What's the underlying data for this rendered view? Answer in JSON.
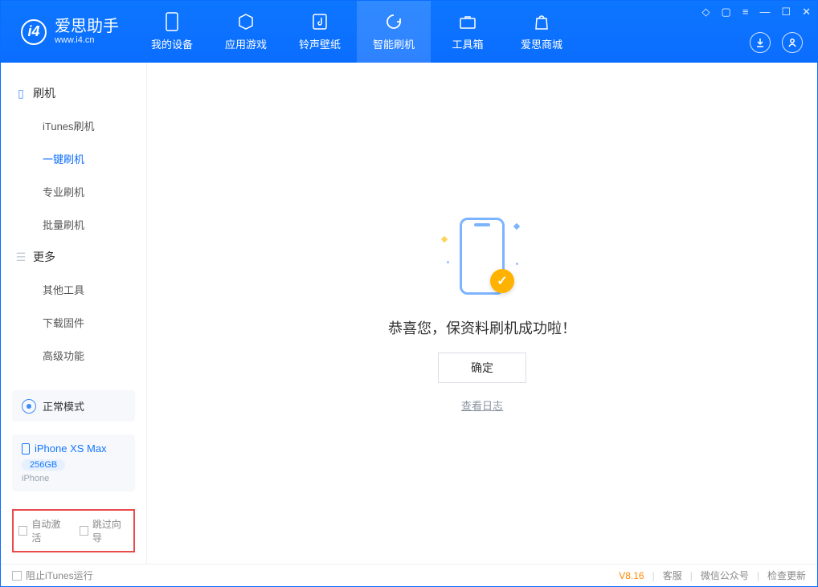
{
  "app": {
    "title": "爱思助手",
    "subtitle": "www.i4.cn"
  },
  "nav": {
    "items": [
      {
        "label": "我的设备"
      },
      {
        "label": "应用游戏"
      },
      {
        "label": "铃声壁纸"
      },
      {
        "label": "智能刷机"
      },
      {
        "label": "工具箱"
      },
      {
        "label": "爱思商城"
      }
    ]
  },
  "sidebar": {
    "group1": "刷机",
    "group2": "更多",
    "items1": [
      {
        "label": "iTunes刷机"
      },
      {
        "label": "一键刷机"
      },
      {
        "label": "专业刷机"
      },
      {
        "label": "批量刷机"
      }
    ],
    "items2": [
      {
        "label": "其他工具"
      },
      {
        "label": "下载固件"
      },
      {
        "label": "高级功能"
      }
    ]
  },
  "mode": {
    "label": "正常模式"
  },
  "device": {
    "name": "iPhone XS Max",
    "storage": "256GB",
    "type": "iPhone"
  },
  "checks": {
    "auto_activate": "自动激活",
    "skip_guide": "跳过向导"
  },
  "main": {
    "success_text": "恭喜您，保资料刷机成功啦！",
    "ok_label": "确定",
    "log_label": "查看日志"
  },
  "footer": {
    "block_itunes": "阻止iTunes运行",
    "version": "V8.16",
    "support": "客服",
    "wechat": "微信公众号",
    "update": "检查更新"
  }
}
